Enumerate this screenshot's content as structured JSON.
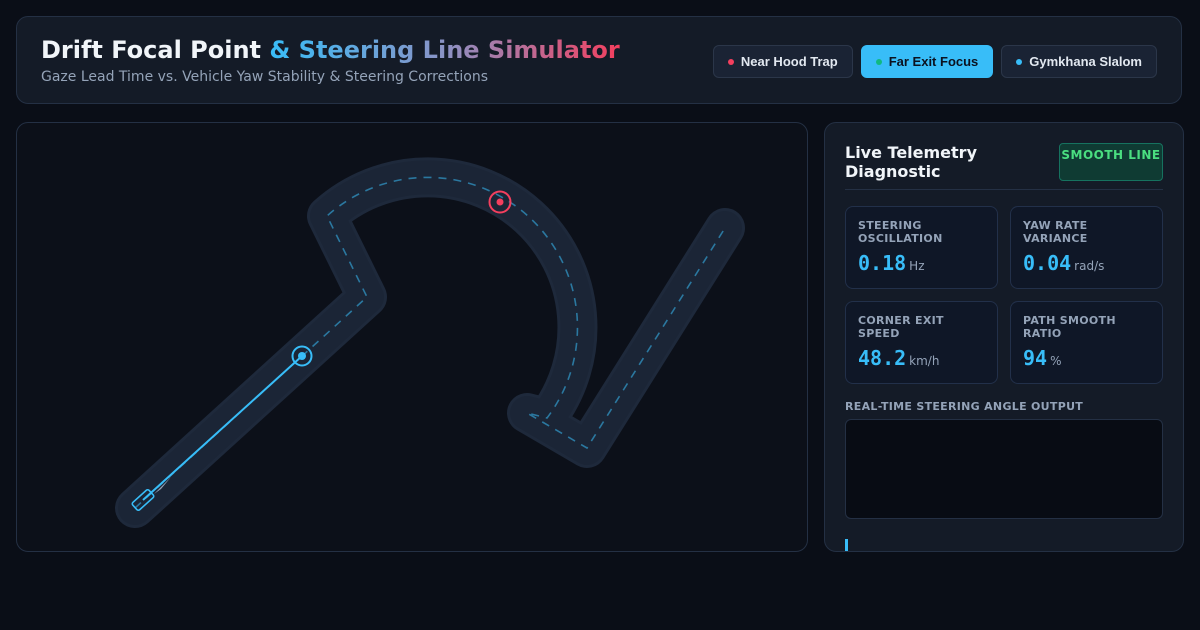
{
  "header": {
    "title_part1": "Drift Focal Point",
    "title_part2": "& Steering Line Simulator",
    "subtitle": "Gaze Lead Time vs. Vehicle Yaw Stability & Steering Corrections"
  },
  "presets": [
    {
      "label": "Near Hood Trap",
      "dot_color": "#f43f5e",
      "active": false
    },
    {
      "label": "Far Exit Focus",
      "dot_color": "#10b981",
      "active": true
    },
    {
      "label": "Gymkhana Slalom",
      "dot_color": "#38bdf8",
      "active": false
    }
  ],
  "telemetry": {
    "title": "Live Telemetry Diagnostic",
    "status": "SMOOTH LINE",
    "metrics": [
      {
        "label": "STEERING OSCILLATION",
        "value": "0.18",
        "unit": "Hz"
      },
      {
        "label": "YAW RATE VARIANCE",
        "value": "0.04",
        "unit": "rad/s"
      },
      {
        "label": "CORNER EXIT SPEED",
        "value": "48.2",
        "unit": "km/h"
      },
      {
        "label": "PATH SMOOTH RATIO",
        "value": "94",
        "unit": "%"
      }
    ],
    "steering_label": "REAL-TIME STEERING ANGLE OUTPUT"
  },
  "colors": {
    "accent": "#38bdf8",
    "near_marker": "#f43f5e",
    "status_good": "#4ade80",
    "track": "#1b2536"
  }
}
